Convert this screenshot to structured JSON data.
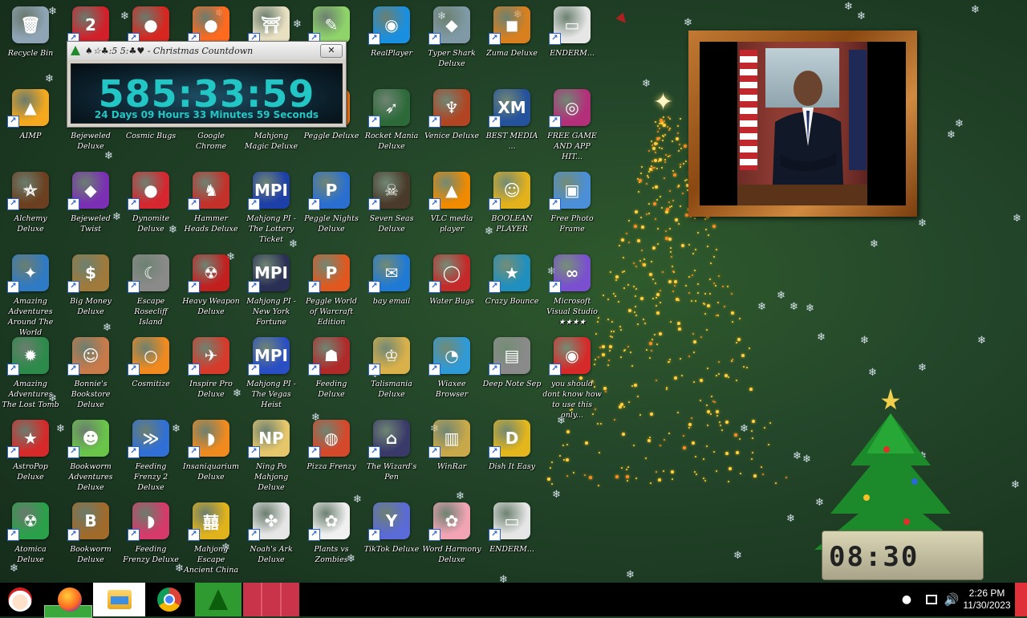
{
  "colors": {
    "desktop_bg": "#1b3821",
    "countdown_text": "#22c6c4",
    "taskbar_bg": "#000000"
  },
  "countdown": {
    "title": "♠☆♣:5 5:♣♥ - Christmas Countdown",
    "time": "585:33:59",
    "detail": "24 Days 09 Hours 33 Minutes 59 Seconds",
    "close_glyph": "✕"
  },
  "desktop_icons": [
    {
      "label": "Recycle Bin",
      "icon": "recycle-bin-icon",
      "glyph": "🗑",
      "color": "#8fa4b4",
      "shortcut": false
    },
    {
      "label": "",
      "icon": "number-two-game-icon",
      "glyph": "2",
      "color": "#d2202a",
      "shortcut": true
    },
    {
      "label": "",
      "icon": "red-fuzzy-creature-icon",
      "glyph": "●",
      "color": "#d7261f",
      "shortcut": true
    },
    {
      "label": "",
      "icon": "firefox-icon",
      "glyph": "●",
      "color": "#ff6a1f",
      "shortcut": true
    },
    {
      "label": "",
      "icon": "shrine-gate-icon",
      "glyph": "⛩",
      "color": "#e9e0c2",
      "shortcut": true
    },
    {
      "label": "",
      "icon": "frog-notepad-icon",
      "glyph": "✎",
      "color": "#8fd46a",
      "shortcut": true
    },
    {
      "label": "RealPlayer",
      "icon": "realplayer-icon",
      "glyph": "◉",
      "color": "#1a8fe0",
      "shortcut": true
    },
    {
      "label": "Typer Shark Deluxe",
      "icon": "shark-icon",
      "glyph": "◆",
      "color": "#7f9aa6",
      "shortcut": true
    },
    {
      "label": "Zuma Deluxe",
      "icon": "zuma-frog-icon",
      "glyph": "◼",
      "color": "#d8801f",
      "shortcut": true
    },
    {
      "label": "ENDERM...",
      "icon": "window-app-icon",
      "glyph": "▭",
      "color": "#e6e6e6",
      "shortcut": true
    },
    {
      "label": "AIMP",
      "icon": "aimp-icon",
      "glyph": "▲",
      "color": "#f4a81d",
      "shortcut": true
    },
    {
      "label": "Bejeweled Deluxe",
      "icon": "bejeweled-icon",
      "glyph": "◆",
      "color": "#3f6fd6",
      "shortcut": true
    },
    {
      "label": "Cosmic Bugs",
      "icon": "cosmic-bugs-icon",
      "glyph": "●",
      "color": "#3aa84f",
      "shortcut": true
    },
    {
      "label": "Google Chrome",
      "icon": "chrome-icon",
      "glyph": "◎",
      "color": "#db4437",
      "shortcut": true
    },
    {
      "label": "Mahjong Magic Deluxe",
      "icon": "mahjong-icon",
      "glyph": "▦",
      "color": "#c63c3c",
      "shortcut": true
    },
    {
      "label": "Peggle Deluxe",
      "icon": "peggle-icon",
      "glyph": "●",
      "color": "#f07a1f",
      "shortcut": true
    },
    {
      "label": "Rocket Mania Deluxe",
      "icon": "rocket-icon",
      "glyph": "➶",
      "color": "#2d6a3a",
      "shortcut": true
    },
    {
      "label": "Venice Deluxe",
      "icon": "venice-icon",
      "glyph": "♆",
      "color": "#b14422",
      "shortcut": true
    },
    {
      "label": "BEST MEDIA ...",
      "icon": "xm-player-icon",
      "glyph": "XM",
      "color": "#24529c",
      "shortcut": true
    },
    {
      "label": "FREE GAME AND APP HIT...",
      "icon": "disk-icon",
      "glyph": "◎",
      "color": "#b42f7a",
      "shortcut": true
    },
    {
      "label": "Alchemy Deluxe",
      "icon": "wizard-icon",
      "glyph": "⛤",
      "color": "#6b3f1f",
      "shortcut": true
    },
    {
      "label": "Bejeweled Twist",
      "icon": "bejeweled-twist-icon",
      "glyph": "◆",
      "color": "#7a2fb4",
      "shortcut": true
    },
    {
      "label": "Dynomite Deluxe",
      "icon": "egg-icon",
      "glyph": "●",
      "color": "#d6262f",
      "shortcut": true
    },
    {
      "label": "Hammer Heads Deluxe",
      "icon": "gnome-icon",
      "glyph": "♞",
      "color": "#c4302a",
      "shortcut": true
    },
    {
      "label": "Mahjong PI - The Lottery Ticket",
      "icon": "mpi-icon",
      "glyph": "MPI",
      "color": "#1d3fa8",
      "shortcut": true
    },
    {
      "label": "Peggle Nights Deluxe",
      "icon": "peggle-nights-icon",
      "glyph": "P",
      "color": "#2a6fd0",
      "shortcut": true
    },
    {
      "label": "Seven Seas Deluxe",
      "icon": "skull-icon",
      "glyph": "☠",
      "color": "#4a3a2a",
      "shortcut": true
    },
    {
      "label": "VLC media player",
      "icon": "vlc-icon",
      "glyph": "▲",
      "color": "#f08a00",
      "shortcut": true
    },
    {
      "label": "BOOLEAN PLAYER",
      "icon": "smiley-robot-icon",
      "glyph": "☺",
      "color": "#e2b11c",
      "shortcut": true
    },
    {
      "label": "Free Photo Frame",
      "icon": "photo-icon",
      "glyph": "▣",
      "color": "#4a8fd8",
      "shortcut": true
    },
    {
      "label": "Amazing Adventures Around The World",
      "icon": "compass-gem-icon",
      "glyph": "✦",
      "color": "#2f7ac4",
      "shortcut": true
    },
    {
      "label": "Big Money Deluxe",
      "icon": "money-bag-icon",
      "glyph": "$",
      "color": "#a07a3a",
      "shortcut": true
    },
    {
      "label": "Escape Rosecliff Island",
      "icon": "moon-icon",
      "glyph": "☾",
      "color": "#8a8a8a",
      "shortcut": true
    },
    {
      "label": "Heavy Weapon Deluxe",
      "icon": "radiation-icon",
      "glyph": "☢",
      "color": "#c21f1f",
      "shortcut": true
    },
    {
      "label": "Mahjong PI - New York Fortune",
      "icon": "mpi-shield-icon",
      "glyph": "MPI",
      "color": "#2a2f55",
      "shortcut": true
    },
    {
      "label": "Peggle World of Warcraft Edition",
      "icon": "peggle-wow-icon",
      "glyph": "P",
      "color": "#e0581f",
      "shortcut": true
    },
    {
      "label": "bay email",
      "icon": "thunderbird-icon",
      "glyph": "✉",
      "color": "#1f7ad6",
      "shortcut": true
    },
    {
      "label": "Water Bugs",
      "icon": "water-bugs-icon",
      "glyph": "◯",
      "color": "#c42a2a",
      "shortcut": true
    },
    {
      "label": "Crazy Bounce",
      "icon": "star-tile-icon",
      "glyph": "★",
      "color": "#1f8fbf",
      "shortcut": true
    },
    {
      "label": "Microsoft Visual Studio ★★★★",
      "icon": "infinity-icon",
      "glyph": "∞",
      "color": "#7a4fd0",
      "shortcut": true
    },
    {
      "label": "Amazing Adventures The Lost Tomb",
      "icon": "globe-compass-icon",
      "glyph": "✹",
      "color": "#2c8a4a",
      "shortcut": true
    },
    {
      "label": "Bonnie's Bookstore Deluxe",
      "icon": "girl-face-icon",
      "glyph": "☺",
      "color": "#c97a4a",
      "shortcut": true
    },
    {
      "label": "Cosmitize",
      "icon": "orange-ring-icon",
      "glyph": "○",
      "color": "#f08a1f",
      "shortcut": true
    },
    {
      "label": "Inspire Pro Deluxe",
      "icon": "helicopter-icon",
      "glyph": "✈",
      "color": "#d63a2a",
      "shortcut": true
    },
    {
      "label": "Mahjong PI - The Vegas Heist",
      "icon": "mpi-blue-icon",
      "glyph": "MPI",
      "color": "#2a4fc4",
      "shortcut": true
    },
    {
      "label": "Feeding Deluxe",
      "icon": "pirate-icon",
      "glyph": "☗",
      "color": "#b02a2a",
      "shortcut": true
    },
    {
      "label": "Talismania Deluxe",
      "icon": "king-icon",
      "glyph": "♔",
      "color": "#d9b04a",
      "shortcut": true
    },
    {
      "label": "Wiaxee Browser",
      "icon": "edge-icon",
      "glyph": "◔",
      "color": "#2f9ad6",
      "shortcut": true
    },
    {
      "label": "Deep Note Sep",
      "icon": "stacked-squares-icon",
      "glyph": "▤",
      "color": "#8a8a8a",
      "shortcut": true
    },
    {
      "label": "you should dont know how to use this only...",
      "icon": "red-swirl-icon",
      "glyph": "◉",
      "color": "#d62a2a",
      "shortcut": true
    },
    {
      "label": "AstroPop Deluxe",
      "icon": "astropop-icon",
      "glyph": "★",
      "color": "#d62a2a",
      "shortcut": true
    },
    {
      "label": "Bookworm Adventures Deluxe",
      "icon": "bookworm-icon",
      "glyph": "☻",
      "color": "#6ac44a",
      "shortcut": true
    },
    {
      "label": "Feeding Frenzy 2 Deluxe",
      "icon": "fish-icon",
      "glyph": "≫",
      "color": "#2f6fd6",
      "shortcut": true
    },
    {
      "label": "Insaniquarium Deluxe",
      "icon": "goldfish-icon",
      "glyph": "◗",
      "color": "#f08a1f",
      "shortcut": true
    },
    {
      "label": "Ning Po Mahjong Deluxe",
      "icon": "ning-po-icon",
      "glyph": "NP",
      "color": "#e6c66a",
      "shortcut": true
    },
    {
      "label": "Pizza Frenzy",
      "icon": "pizza-icon",
      "glyph": "◍",
      "color": "#d6482a",
      "shortcut": true
    },
    {
      "label": "The Wizard's Pen",
      "icon": "wizard-house-icon",
      "glyph": "⌂",
      "color": "#3a3a6a",
      "shortcut": true
    },
    {
      "label": "WinRar",
      "icon": "winrar-icon",
      "glyph": "▥",
      "color": "#c9a84a",
      "shortcut": true
    },
    {
      "label": "Dish It Easy",
      "icon": "dish-it-icon",
      "glyph": "D",
      "color": "#e3b61c",
      "shortcut": true
    },
    {
      "label": "",
      "icon": "blank-icon",
      "glyph": "",
      "color": "transparent",
      "shortcut": false
    },
    {
      "label": "Atomica Deluxe",
      "icon": "atomica-icon",
      "glyph": "☢",
      "color": "#2aa04a",
      "shortcut": true
    },
    {
      "label": "Bookworm Deluxe",
      "icon": "book-icon",
      "glyph": "B",
      "color": "#a06a2a",
      "shortcut": true
    },
    {
      "label": "Feeding Frenzy Deluxe",
      "icon": "fish-pink-icon",
      "glyph": "◗",
      "color": "#d63a6a",
      "shortcut": true
    },
    {
      "label": "Mahjong Escape Ancient China",
      "icon": "mahjong-tile-icon",
      "glyph": "囍",
      "color": "#e0b21c",
      "shortcut": true
    },
    {
      "label": "Noah's Ark Deluxe",
      "icon": "dove-icon",
      "glyph": "✤",
      "color": "#e6e6e6",
      "shortcut": true
    },
    {
      "label": "Plants vs Zombies",
      "icon": "flower-icon",
      "glyph": "✿",
      "color": "#f0f0f0",
      "shortcut": true
    },
    {
      "label": "TikTok Deluxe",
      "icon": "cocktail-icon",
      "glyph": "Y",
      "color": "#5a6ad6",
      "shortcut": true
    },
    {
      "label": "Word Harmony Deluxe",
      "icon": "pink-flower-icon",
      "glyph": "✿",
      "color": "#f2a4b4",
      "shortcut": true
    },
    {
      "label": "ENDERM...",
      "icon": "window-app-2-icon",
      "glyph": "▭",
      "color": "#e6e6e6",
      "shortcut": true
    }
  ],
  "clock_widget": {
    "digits": "08:30"
  },
  "taskbar": {
    "tray_dot": "●",
    "volume_glyph": "🔊",
    "time": "2:26 PM",
    "date": "11/30/2023"
  }
}
